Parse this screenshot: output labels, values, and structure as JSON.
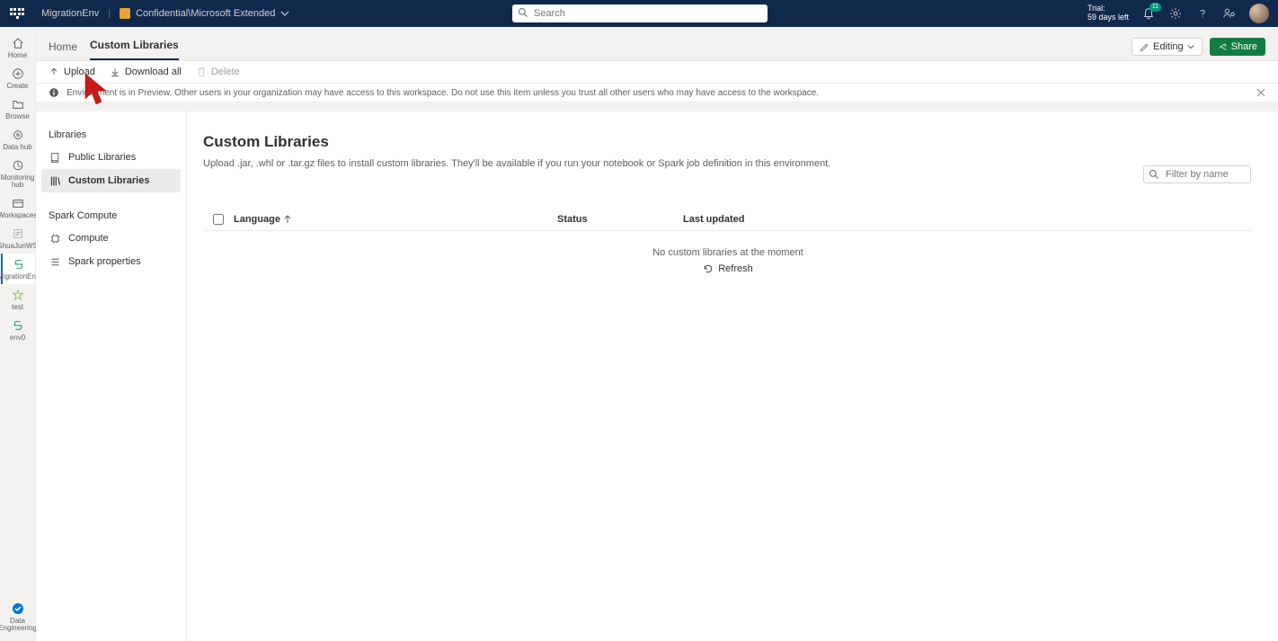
{
  "topbar": {
    "title": "MigrationEnv",
    "sensitivity": "Confidential\\Microsoft Extended",
    "search_placeholder": "Search",
    "trial_label": "Trial:",
    "trial_days": "59 days left",
    "notif_count": "11"
  },
  "leftrail": {
    "home": "Home",
    "create": "Create",
    "browse": "Browse",
    "datahub": "Data hub",
    "monitoring": "Monitoring hub",
    "workspaces": "Workspaces",
    "shuajunws": "ShuaJunWS",
    "migration": "MigrationEnv",
    "test": "test",
    "env0": "env0",
    "bottom": "Data Engineering"
  },
  "breadcrumb": {
    "home": "Home",
    "current": "Custom Libraries"
  },
  "headbuttons": {
    "editing": "Editing",
    "share": "Share"
  },
  "toolbar": {
    "upload": "Upload",
    "download": "Download all",
    "delete": "Delete"
  },
  "infobar": {
    "text": "Environment is in Preview. Other users in your organization may have access to this workspace. Do not use this item unless you trust all other users who may have access to the workspace."
  },
  "sidepanel": {
    "libraries_head": "Libraries",
    "public": "Public Libraries",
    "custom": "Custom Libraries",
    "spark_head": "Spark Compute",
    "compute": "Compute",
    "spark_props": "Spark properties"
  },
  "body": {
    "title": "Custom Libraries",
    "subtitle": "Upload .jar, .whl or .tar.gz files to install custom libraries. They'll be available if you run your notebook or Spark job definition in this environment.",
    "filter_placeholder": "Filter by name",
    "col_language": "Language",
    "col_status": "Status",
    "col_updated": "Last updated",
    "empty_text": "No custom libraries at the moment",
    "refresh": "Refresh"
  }
}
